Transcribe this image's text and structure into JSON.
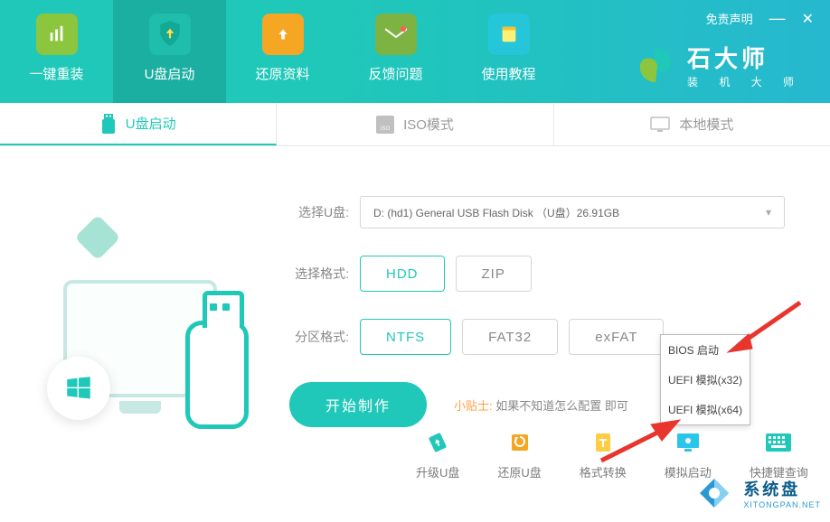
{
  "header": {
    "disclaimer": "免责声明",
    "brand_title": "石大师",
    "brand_sub": "装 机 大 师"
  },
  "nav": {
    "items": [
      {
        "label": "一键重装"
      },
      {
        "label": "U盘启动"
      },
      {
        "label": "还原资料"
      },
      {
        "label": "反馈问题"
      },
      {
        "label": "使用教程"
      }
    ]
  },
  "modes": {
    "items": [
      {
        "label": "U盘启动"
      },
      {
        "label": "ISO模式"
      },
      {
        "label": "本地模式"
      }
    ]
  },
  "form": {
    "usb_label": "选择U盘:",
    "usb_value": "D: (hd1) General USB Flash Disk （U盘）26.91GB",
    "format_label": "选择格式:",
    "format_options": [
      {
        "label": "HDD",
        "selected": true
      },
      {
        "label": "ZIP",
        "selected": false
      }
    ],
    "partition_label": "分区格式:",
    "partition_options": [
      {
        "label": "NTFS",
        "selected": true
      },
      {
        "label": "FAT32",
        "selected": false
      },
      {
        "label": "exFAT",
        "selected": false
      }
    ],
    "start_button": "开始制作",
    "tip_prefix": "小贴士:",
    "tip_text": "如果不知道怎么配置                即可"
  },
  "boot_menu": {
    "items": [
      {
        "label": "BIOS 启动"
      },
      {
        "label": "UEFI 模拟(x32)"
      },
      {
        "label": "UEFI 模拟(x64)"
      }
    ]
  },
  "bottom": {
    "items": [
      {
        "label": "升级U盘"
      },
      {
        "label": "还原U盘"
      },
      {
        "label": "格式转换"
      },
      {
        "label": "模拟启动"
      },
      {
        "label": "快捷键查询"
      }
    ]
  },
  "watermark": {
    "title": "系统盘",
    "url": "XITONGPAN.NET"
  }
}
